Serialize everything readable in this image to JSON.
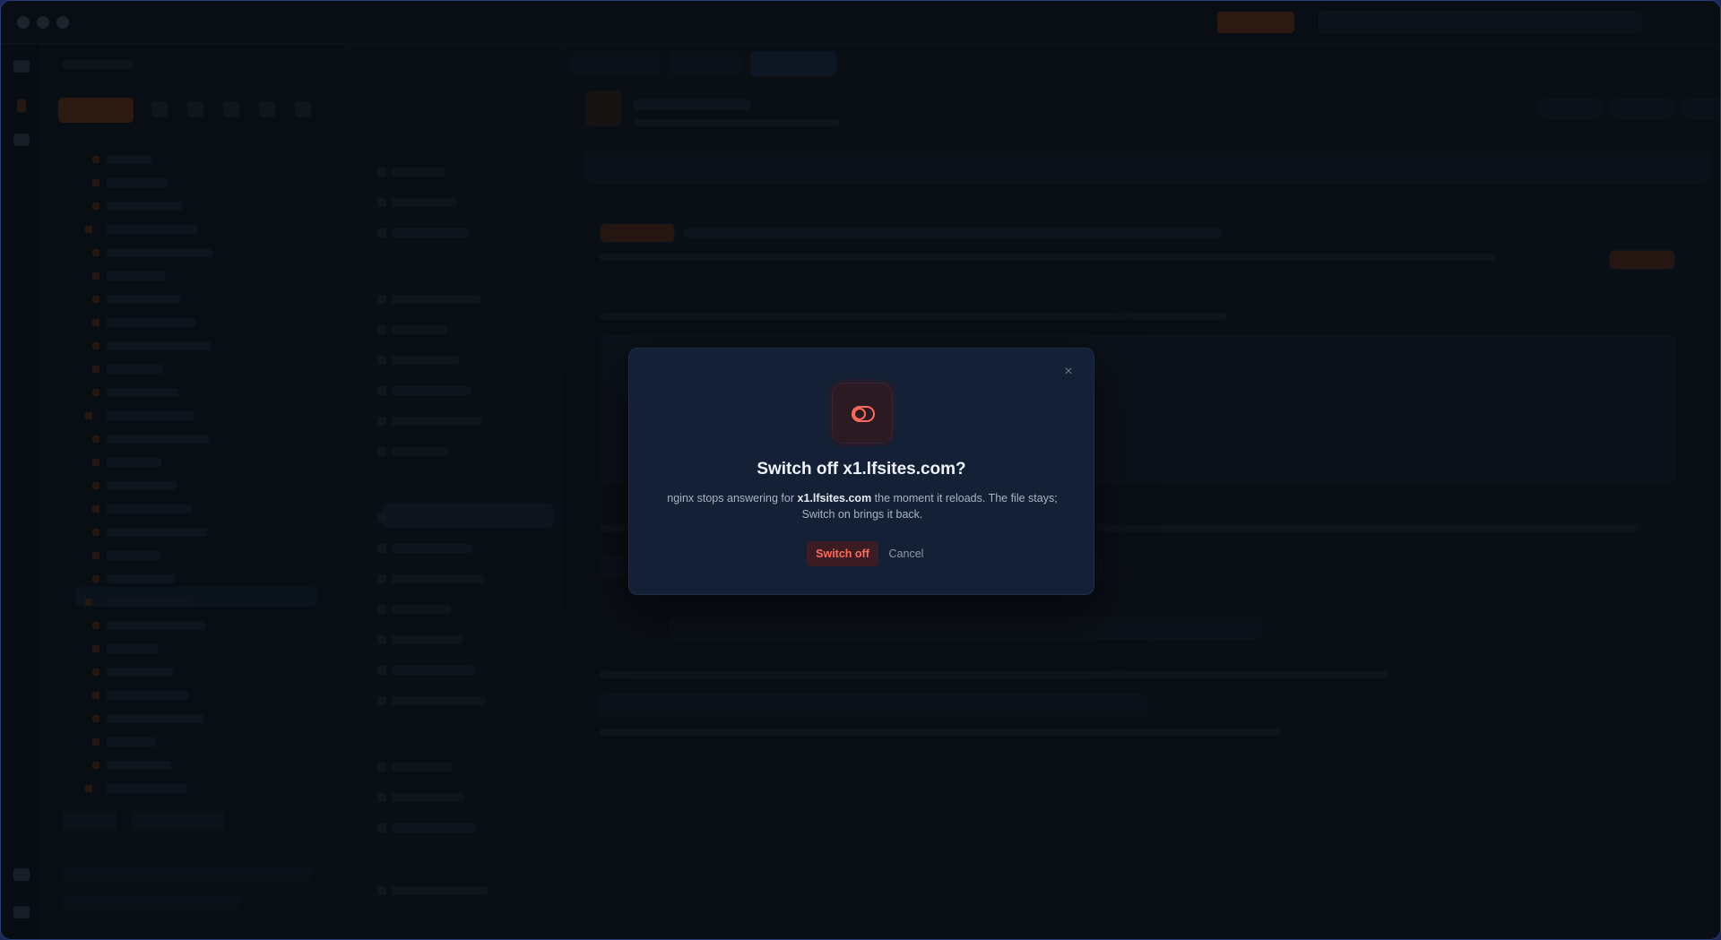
{
  "dialog": {
    "title": "Switch off x1.lfsites.com?",
    "body_prefix": "nginx stops answering for ",
    "domain": "x1.lfsites.com",
    "body_suffix": " the moment it reloads. The file stays; Switch on brings it back.",
    "confirm_label": "Switch off",
    "cancel_label": "Cancel",
    "close_glyph": "×",
    "icon": "toggle-off-icon"
  },
  "colors": {
    "accent_danger": "#ff6b5a",
    "modal_bg": "#132036",
    "backdrop": "#0f141d"
  }
}
